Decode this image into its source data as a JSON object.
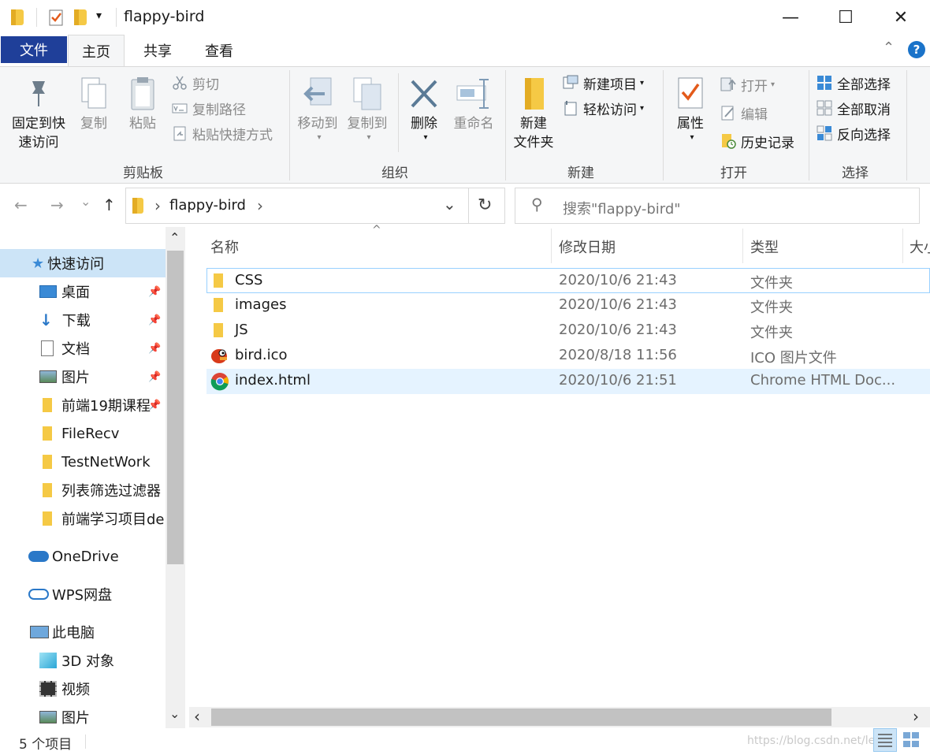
{
  "window": {
    "title": "flappy-bird",
    "minimize_glyph": "—",
    "maximize_glyph": "☐",
    "close_glyph": "✕"
  },
  "quick_access_toolbar": {
    "dropdown_glyph": "▾"
  },
  "tabs": [
    {
      "label": "文件"
    },
    {
      "label": "主页"
    },
    {
      "label": "共享"
    },
    {
      "label": "查看"
    }
  ],
  "help_glyph": "?",
  "collapse_glyph": "⌃",
  "ribbon": {
    "clipboard": {
      "label": "剪贴板",
      "pin_line1": "固定到快",
      "pin_line2": "速访问",
      "copy": "复制",
      "paste": "粘贴",
      "cut": "剪切",
      "copy_path": "复制路径",
      "paste_shortcut": "粘贴快捷方式"
    },
    "organize": {
      "label": "组织",
      "move_to": "移动到",
      "copy_to": "复制到",
      "delete": "删除",
      "rename": "重命名"
    },
    "new": {
      "label": "新建",
      "new_folder_line1": "新建",
      "new_folder_line2": "文件夹",
      "new_item": "新建项目",
      "easy_access": "轻松访问"
    },
    "open": {
      "label": "打开",
      "properties": "属性",
      "open": "打开",
      "edit": "编辑",
      "history": "历史记录"
    },
    "select": {
      "label": "选择",
      "select_all": "全部选择",
      "select_none": "全部取消",
      "invert": "反向选择"
    }
  },
  "nav": {
    "back_glyph": "←",
    "forward_glyph": "→",
    "recent_glyph": "⌄",
    "up_glyph": "↑"
  },
  "address": {
    "separator": "›",
    "segment": "flappy-bird",
    "trail_separator": "›",
    "dropdown_glyph": "⌄",
    "refresh_glyph": "↻"
  },
  "search": {
    "placeholder": "搜索\"flappy-bird\"",
    "icon_glyph": "⚲"
  },
  "navpane": {
    "quick_access": "快速访问",
    "pinned": [
      {
        "label": "桌面",
        "icon": "desktop-icon"
      },
      {
        "label": "下载",
        "icon": "download-icon"
      },
      {
        "label": "文档",
        "icon": "document-icon"
      },
      {
        "label": "图片",
        "icon": "pictures-icon"
      },
      {
        "label": "前端19期课程",
        "icon": "folder-icon"
      }
    ],
    "recent": [
      {
        "label": "FileRecv"
      },
      {
        "label": "TestNetWork"
      },
      {
        "label": "列表筛选过滤器"
      },
      {
        "label": "前端学习项目de"
      }
    ],
    "onedrive": "OneDrive",
    "wps": "WPS网盘",
    "this_pc": "此电脑",
    "pc_items": [
      {
        "label": "3D 对象",
        "icon": "3d-objects-icon"
      },
      {
        "label": "视频",
        "icon": "video-icon"
      },
      {
        "label": "图片",
        "icon": "pictures-icon"
      }
    ],
    "pin_glyph": "📌",
    "scroll_up": "⌃",
    "scroll_down": "⌄"
  },
  "filelist": {
    "sort_glyph": "^",
    "columns": {
      "name": "名称",
      "date": "修改日期",
      "type": "类型",
      "size": "大小"
    },
    "rows": [
      {
        "name": "CSS",
        "date": "2020/10/6 21:43",
        "type": "文件夹",
        "icon": "folder-icon"
      },
      {
        "name": "images",
        "date": "2020/10/6 21:43",
        "type": "文件夹",
        "icon": "folder-icon"
      },
      {
        "name": "JS",
        "date": "2020/10/6 21:43",
        "type": "文件夹",
        "icon": "folder-icon"
      },
      {
        "name": "bird.ico",
        "date": "2020/8/18 11:56",
        "type": "ICO 图片文件",
        "icon": "flappy-bird-icon"
      },
      {
        "name": "index.html",
        "date": "2020/10/6 21:51",
        "type": "Chrome HTML Doc...",
        "icon": "chrome-icon"
      }
    ],
    "hscroll_left": "‹",
    "hscroll_right": "›"
  },
  "status": {
    "item_count": "5 个项目",
    "watermark": "https://blog.csdn.net/le"
  }
}
